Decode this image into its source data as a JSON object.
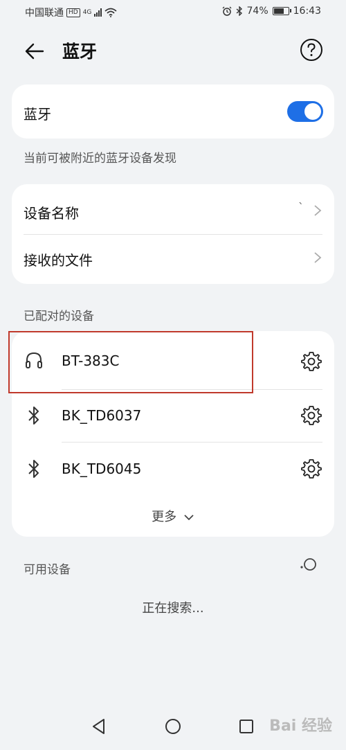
{
  "status_bar": {
    "carrier": "中国联通",
    "hd": "HD",
    "network": "4G",
    "battery": "74%",
    "battery_level": 0.74,
    "time": "16:43"
  },
  "header": {
    "title": "蓝牙"
  },
  "bluetooth_card": {
    "label": "蓝牙",
    "enabled": true
  },
  "visibility_text": "当前可被附近的蓝牙设备发现",
  "settings_card": {
    "device_name_label": "设备名称",
    "device_name_value": "`",
    "received_files_label": "接收的文件"
  },
  "paired": {
    "header": "已配对的设备",
    "devices": [
      {
        "name": "BT-383C",
        "icon": "headphones-icon"
      },
      {
        "name": "BK_TD6037",
        "icon": "bluetooth-icon"
      },
      {
        "name": "BK_TD6045",
        "icon": "bluetooth-icon"
      }
    ],
    "more_label": "更多"
  },
  "available": {
    "header": "可用设备",
    "searching_text": "正在搜索..."
  },
  "watermark": "Bai 经验"
}
